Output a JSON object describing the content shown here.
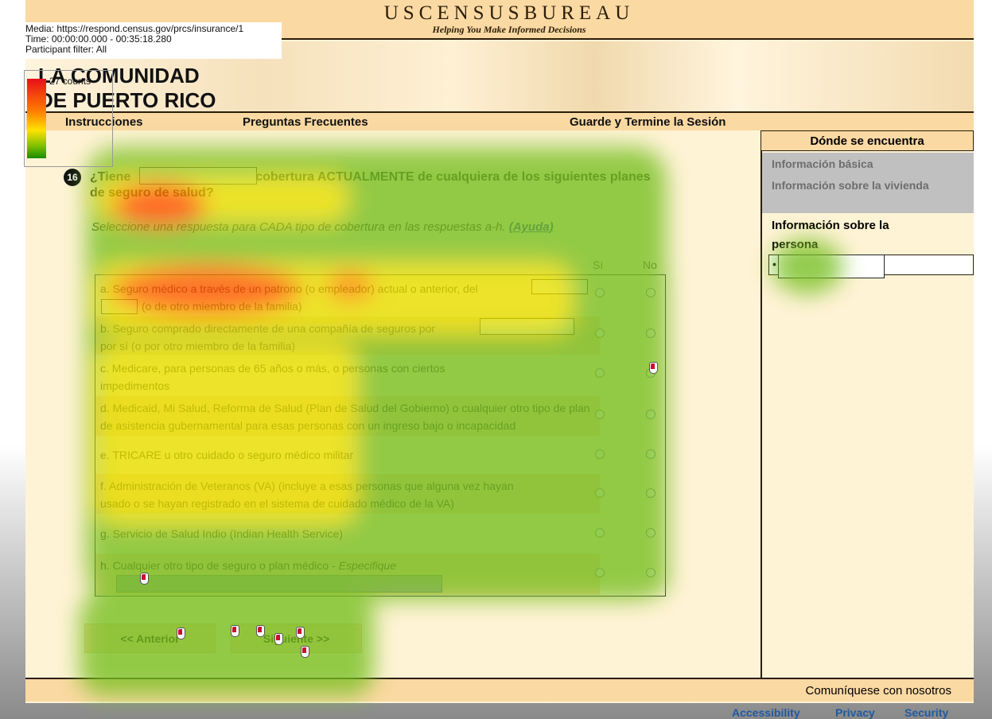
{
  "overlay": {
    "media": "Media: https://respond.census.gov/prcs/insurance/1",
    "time": "Time: 00:00:00.000 - 00:35:18.280",
    "filter": "Participant filter: All",
    "legend_label": "27 counts"
  },
  "header": {
    "brand_title": "USCENSUSBUREAU",
    "brand_tagline": "Helping You Make Informed Decisions",
    "community_line1": "LA COMUNIDAD",
    "community_line2": "DE PUERTO RICO"
  },
  "nav": {
    "instructions": "Instrucciones",
    "faq": "Preguntas Frecuentes",
    "save_exit": "Guarde y Termine la Sesión"
  },
  "sidebar": {
    "title": "Dónde se encuentra",
    "items": [
      {
        "label": "Información básica",
        "state": "completed"
      },
      {
        "label": "Información sobre la vivienda",
        "state": "completed"
      },
      {
        "label": "Información sobre la persona",
        "state": "current"
      }
    ],
    "person_bullet": "•"
  },
  "question": {
    "number": "16",
    "text_start": "¿Tiene",
    "text_rest": "cobertura ACTUALMENTE de cualquiera de los siguientes planes de seguro de salud?",
    "instruction_prefix": "Seleccione una respuesta para CADA tipo de cobertura en las respuestas a-h.",
    "help_link": "(Ayuda)",
    "col_yes": "Sí",
    "col_no": "No"
  },
  "options": [
    {
      "text": "a. Seguro médico a través de un patrono (o empleador) actual o anterior, del",
      "text2": "(o de otro miembro de la familia)"
    },
    {
      "text": "b. Seguro comprado directamente de una compañía de seguros por",
      "text2": "por sí (o por otro miembro de la familia)"
    },
    {
      "text": "c. Medicare, para personas de 65 años o más, o personas con ciertos",
      "text2": "impedimentos"
    },
    {
      "text": "d. Medicaid, Mi Salud, Reforma de Salud (Plan de Salud del Gobierno) o cualquier otro tipo de plan",
      "text2": "de asistencia gubernamental para esas personas con un ingreso bajo o incapacidad"
    },
    {
      "text": "e. TRICARE u otro cuidado o seguro médico militar",
      "text2": ""
    },
    {
      "text": "f. Administración de Veteranos (VA) (incluye a esas personas que alguna vez hayan",
      "text2": "usado o se hayan registrado en el sistema de cuidado médico de la VA)"
    },
    {
      "text": "g. Servicio de Salud Indio (Indian Health Service)",
      "text2": ""
    },
    {
      "text": "h. Cualquier otro tipo de seguro o plan médico -",
      "spec_label": "Especifique"
    }
  ],
  "buttons": {
    "previous": "<< Anterior",
    "next": "Siguiente >>"
  },
  "footer": {
    "contact": "Comuníquese con nosotros",
    "accessibility": "Accessibility",
    "privacy": "Privacy",
    "security": "Security"
  }
}
